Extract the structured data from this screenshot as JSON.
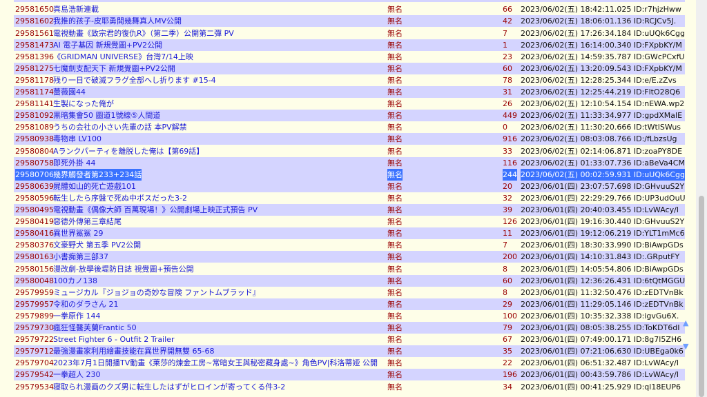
{
  "threads": [
    {
      "id": "29581650",
      "title": "真島浩新連載",
      "author": "無名",
      "count": "66",
      "date": "2023/06/02(五) 18:42:11.025 ID:r7hjzHww"
    },
    {
      "id": "29581602",
      "title": "我推的孩子-皮耶勇開幾舞真人MV公開",
      "author": "無名",
      "count": "42",
      "date": "2023/06/02(五) 18:06:01.136 ID:RCJCv5J."
    },
    {
      "id": "29581561",
      "title": "電視動畫《致宗君的復仇R》（第二季）公開第二彈 PV",
      "author": "無名",
      "count": "7",
      "date": "2023/06/02(五) 17:26:34.184 ID:uUQk6Cgg"
    },
    {
      "id": "29581473",
      "title": "AI 電子基因 新規覺圖+PV2公開",
      "author": "無名",
      "count": "1",
      "date": "2023/06/02(五) 16:14:00.340 ID:FXpbKY/M"
    },
    {
      "id": "29581396",
      "title": "《GRIDMAN UNIVERSE》台灣7/14上映",
      "author": "無名",
      "count": "23",
      "date": "2023/06/02(五) 14:59:35.787 ID:GWcPCxfU"
    },
    {
      "id": "29581275",
      "title": "七魔劍支配天下 新規覺圖+PV2公開",
      "author": "無名",
      "count": "60",
      "date": "2023/06/02(五) 13:20:09.543 ID:FXpbKY/M"
    },
    {
      "id": "29581178",
      "title": "残り一日で破滅フラグ全部へし折ります #15-4",
      "author": "無名",
      "count": "78",
      "date": "2023/06/02(五) 12:28:25.344 ID:e/E.zZvs"
    },
    {
      "id": "29581174",
      "title": "蕾薇園44",
      "author": "無名",
      "count": "31",
      "date": "2023/06/02(五) 12:25:44.219 ID:FltO28Q6"
    },
    {
      "id": "29581141",
      "title": "生製になった俺が",
      "author": "無名",
      "count": "26",
      "date": "2023/06/02(五) 12:10:54.154 ID:nEWA.wp2"
    },
    {
      "id": "29581092",
      "title": "黒暗集會50 圖道1號線⑤人間道",
      "author": "無名",
      "count": "449",
      "date": "2023/06/02(五) 11:33:34.977 ID:gpdXMalE"
    },
    {
      "id": "29581089",
      "title": "うちの会社の小さい先輩の話 本PV解禁",
      "author": "無名",
      "count": "0",
      "date": "2023/06/02(五) 11:30:20.666 ID:tWtlSWus"
    },
    {
      "id": "29580938",
      "title": "毒物串 LV100",
      "author": "無名",
      "count": "916",
      "date": "2023/06/02(五) 08:03:08.766 ID:/fLbzsUg"
    },
    {
      "id": "29580804",
      "title": "Aランクパーティを離脱した俺は【第69話】",
      "author": "無名",
      "count": "33",
      "date": "2023/06/02(五) 02:14:06.871 ID:zoaPY8DE"
    },
    {
      "id": "29580758",
      "title": "即死外掛 44",
      "author": "無名",
      "count": "116",
      "date": "2023/06/02(五) 01:33:07.736 ID:aBeVa4CM"
    },
    {
      "id": "29580706",
      "title": "幾界觸發者第233+234話",
      "author": "無名",
      "count": "244",
      "date": "2023/06/02(五) 00:02:59.931 ID:uUQk6Cgg",
      "selected": true
    },
    {
      "id": "29580639",
      "title": "屍體如山的死亡遊戲101",
      "author": "無名",
      "count": "20",
      "date": "2023/06/01(四) 23:07:57.698 ID:GHvuuS2Y"
    },
    {
      "id": "29580596",
      "title": "転生したら序盤で死ぬ中ボスだった3-2",
      "author": "無名",
      "count": "32",
      "date": "2023/06/01(四) 22:29:29.766 ID:UP3udOuU"
    },
    {
      "id": "29580495",
      "title": "電視動畫《偶像大師 百萬現場！》公開劇場上映正式預告 PV",
      "author": "無名",
      "count": "39",
      "date": "2023/06/01(四) 20:40:03.455 ID:LvWAcy/I"
    },
    {
      "id": "29580419",
      "title": "惡德外傳第三章結尾",
      "author": "無名",
      "count": "126",
      "date": "2023/06/01(四) 19:16:30.440 ID:GHvuuS2Y"
    },
    {
      "id": "29580416",
      "title": "異世界鯊鯊 29",
      "author": "無名",
      "count": "11",
      "date": "2023/06/01(四) 19:12:06.219 ID:YLT1mMc6"
    },
    {
      "id": "29580376",
      "title": "文豪野犬 第五季 PV2公開",
      "author": "無名",
      "count": "7",
      "date": "2023/06/01(四) 18:30:33.990 ID:BiAwpGDs"
    },
    {
      "id": "29580163",
      "title": "小書痴第三部37",
      "author": "無名",
      "count": "200",
      "date": "2023/06/01(四) 14:10:31.843 ID:.GRputFY"
    },
    {
      "id": "29580156",
      "title": "漫改劇-放學後堤防日誌 視覺圖+預告公開",
      "author": "無名",
      "count": "8",
      "date": "2023/06/01(四) 14:05:54.806 ID:BiAwpGDs"
    },
    {
      "id": "29580048",
      "title": "100カノ138",
      "author": "無名",
      "count": "60",
      "date": "2023/06/01(四) 12:36:26.431 ID:6tQtMGGU"
    },
    {
      "id": "29579959",
      "title": "ミュージカル『ジョジョの奇妙な冒険 ファントムブラッド』",
      "author": "無名",
      "count": "8",
      "date": "2023/06/01(四) 11:32:50.476 ID:zEDTVnBk"
    },
    {
      "id": "29579957",
      "title": "令和のダラさん 21",
      "author": "無名",
      "count": "29",
      "date": "2023/06/01(四) 11:29:05.146 ID:zEDTVnBk"
    },
    {
      "id": "29579899",
      "title": "一拳原作 144",
      "author": "無名",
      "count": "100",
      "date": "2023/06/01(四) 10:35:32.338 ID:igvGu6X."
    },
    {
      "id": "29579730",
      "title": "瘋狂怪醫芙蘭Frantic 50",
      "author": "無名",
      "count": "79",
      "date": "2023/06/01(四) 08:05:38.255 ID:ToKDT6dI"
    },
    {
      "id": "29579722",
      "title": "Street Fighter 6 - Outfit 2 Trailer",
      "author": "無名",
      "count": "67",
      "date": "2023/06/01(四) 07:49:00.171 ID:8g7l5ZH6"
    },
    {
      "id": "29579712",
      "title": "最強漫畫家利用繪畫技能在異世界開無雙 65-68",
      "author": "無名",
      "count": "35",
      "date": "2023/06/01(四) 07:21:06.630 ID:UBEga0k6"
    },
    {
      "id": "29579704",
      "title": "2023年7月1日開播TV動畫《莱莎的煉金工房~常暗女王與秘密藏身處~》角色PV|科洛蒂娅 公開",
      "author": "無名",
      "count": "22",
      "date": "2023/06/01(四) 06:51:32.487 ID:LvWAcy/I"
    },
    {
      "id": "29579542",
      "title": "一拳超人 230",
      "author": "無名",
      "count": "196",
      "date": "2023/06/01(四) 00:43:59.786 ID:LvWAcy/I"
    },
    {
      "id": "29579534",
      "title": "寝取られ漫画のクズ男に転生したはずがヒロインが寄ってくる件3-2",
      "author": "無名",
      "count": "34",
      "date": "2023/06/01(四) 00:41:25.929 ID:ql18EUP6"
    }
  ],
  "nav": {
    "up_icon": "▲",
    "down_icon": "▼"
  }
}
